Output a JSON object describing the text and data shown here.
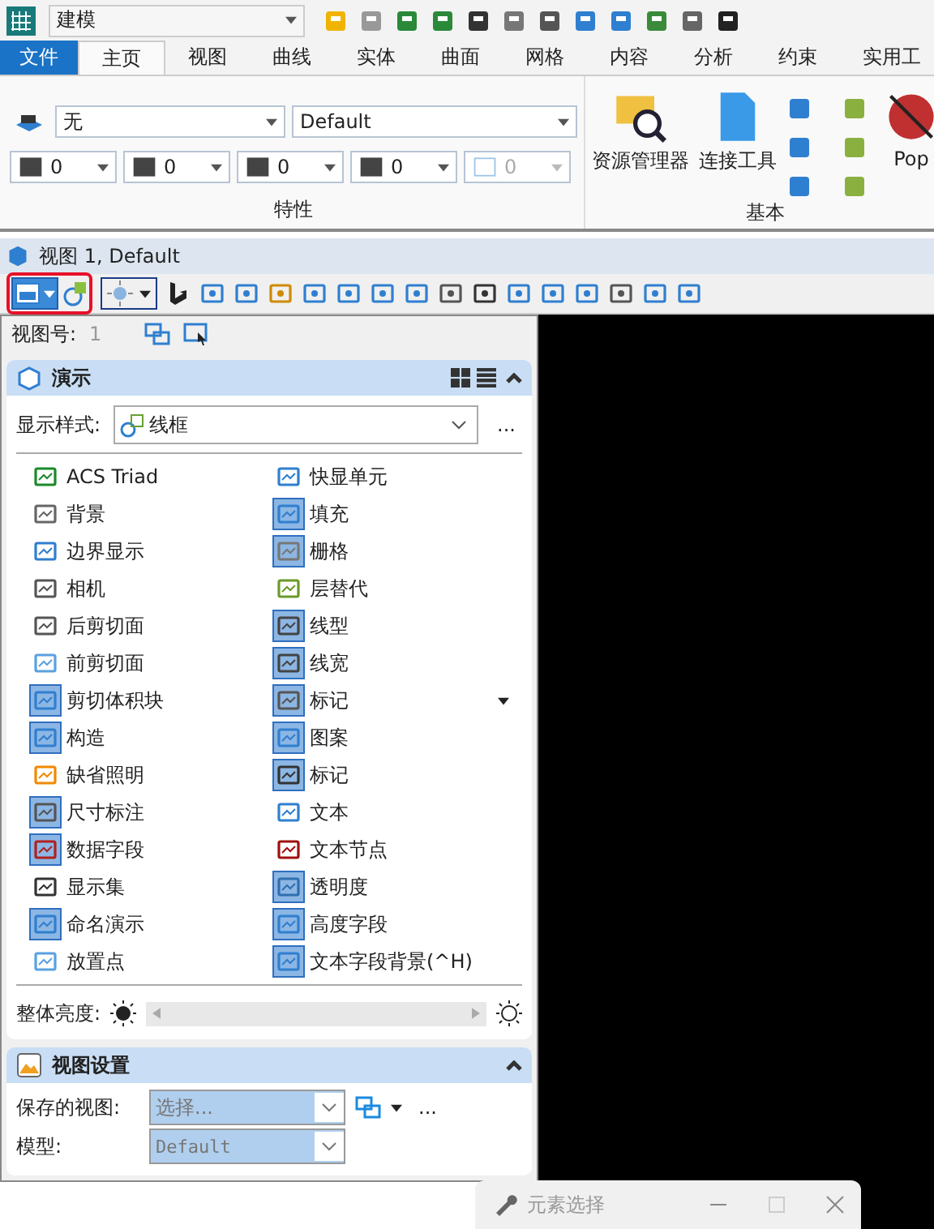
{
  "quick_access": {
    "workflow": "建模"
  },
  "ribbon_tabs": [
    {
      "label": "文件",
      "kind": "file",
      "selected": false
    },
    {
      "label": "主页",
      "kind": "tab",
      "selected": true
    },
    {
      "label": "视图",
      "kind": "tab",
      "selected": false
    },
    {
      "label": "曲线",
      "kind": "tab",
      "selected": false
    },
    {
      "label": "实体",
      "kind": "tab",
      "selected": false
    },
    {
      "label": "曲面",
      "kind": "tab",
      "selected": false
    },
    {
      "label": "网格",
      "kind": "tab",
      "selected": false
    },
    {
      "label": "内容",
      "kind": "tab",
      "selected": false
    },
    {
      "label": "分析",
      "kind": "tab",
      "selected": false
    },
    {
      "label": "约束",
      "kind": "tab",
      "selected": false
    },
    {
      "label": "实用工",
      "kind": "tab",
      "selected": false
    }
  ],
  "properties_group": {
    "label": "特性",
    "level": "无",
    "template": "Default",
    "attributes": [
      {
        "value": "0",
        "disabled": false
      },
      {
        "value": "0",
        "disabled": false
      },
      {
        "value": "0",
        "disabled": false
      },
      {
        "value": "0",
        "disabled": false
      },
      {
        "value": "0",
        "disabled": true
      }
    ]
  },
  "basic_group": {
    "label": "基本",
    "buttons": [
      "资源管理器",
      "连接工具",
      "Pop"
    ]
  },
  "view_window": {
    "title": "视图 1, Default",
    "view_number_label": "视图号:",
    "view_number": "1"
  },
  "presentation": {
    "title": "演示",
    "style_label": "显示样式:",
    "style_value": "线框",
    "more": "...",
    "items": [
      {
        "label": "ACS Triad",
        "on": false,
        "menu": false
      },
      {
        "label": "快显单元",
        "on": false,
        "menu": false
      },
      {
        "label": "背景",
        "on": false,
        "menu": false
      },
      {
        "label": "填充",
        "on": true,
        "menu": false
      },
      {
        "label": "边界显示",
        "on": false,
        "menu": false
      },
      {
        "label": "栅格",
        "on": true,
        "menu": false
      },
      {
        "label": "相机",
        "on": false,
        "menu": false
      },
      {
        "label": "层替代",
        "on": false,
        "menu": false
      },
      {
        "label": "后剪切面",
        "on": false,
        "menu": false
      },
      {
        "label": "线型",
        "on": true,
        "menu": false
      },
      {
        "label": "前剪切面",
        "on": false,
        "menu": false
      },
      {
        "label": "线宽",
        "on": true,
        "menu": false
      },
      {
        "label": "剪切体积块",
        "on": true,
        "menu": false
      },
      {
        "label": "标记",
        "on": true,
        "menu": true
      },
      {
        "label": "构造",
        "on": true,
        "menu": false
      },
      {
        "label": "图案",
        "on": true,
        "menu": false
      },
      {
        "label": "缺省照明",
        "on": false,
        "menu": false
      },
      {
        "label": "标记",
        "on": true,
        "menu": false
      },
      {
        "label": "尺寸标注",
        "on": true,
        "menu": false
      },
      {
        "label": "文本",
        "on": false,
        "menu": false
      },
      {
        "label": "数据字段",
        "on": true,
        "menu": false
      },
      {
        "label": "文本节点",
        "on": false,
        "menu": false
      },
      {
        "label": "显示集",
        "on": false,
        "menu": false
      },
      {
        "label": "透明度",
        "on": true,
        "menu": false
      },
      {
        "label": "命名演示",
        "on": true,
        "menu": false
      },
      {
        "label": "高度字段",
        "on": true,
        "menu": false
      },
      {
        "label": "放置点",
        "on": false,
        "menu": false
      },
      {
        "label": "文本字段背景(^H)",
        "on": true,
        "menu": false
      }
    ],
    "brightness_label": "整体亮度:"
  },
  "view_settings": {
    "title": "视图设置",
    "saved_label": "保存的视图:",
    "saved_placeholder": "选择...",
    "model_label": "模型:",
    "model_value": "Default",
    "more": "..."
  },
  "floating_dialog": {
    "title": "元素选择"
  }
}
